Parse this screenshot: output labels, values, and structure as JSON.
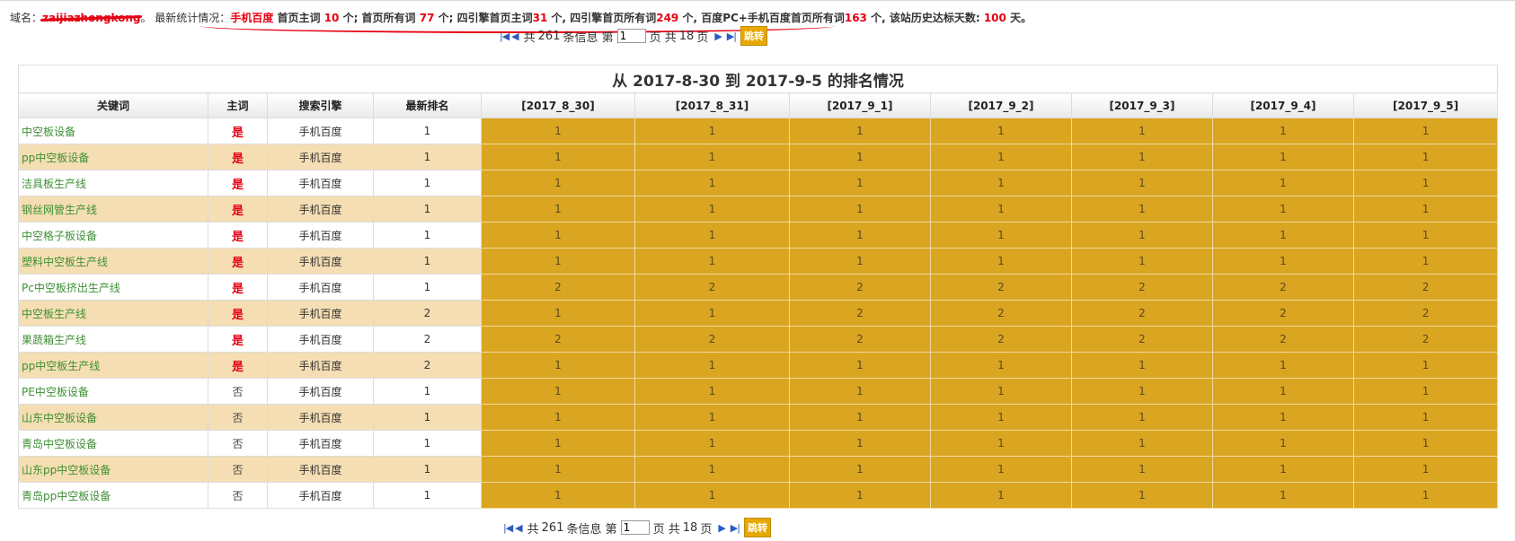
{
  "stats": {
    "domain_label": "域名：",
    "domain_value": "zaijiazhongkong",
    "intro": "。 最新统计情况：",
    "engine": "手机百度",
    "p1": " 首页主词 ",
    "home_main": "10",
    "p2": " 个; 首页所有词 ",
    "home_all": "77",
    "p3": " 个; 四引擎首页主词",
    "four_main": "31",
    "p4": " 个, 四引擎首页所有词",
    "four_all": "249",
    "p5": " 个, 百度PC+手机百度首页所有词",
    "pc_mobile_all": "163",
    "p6": " 个, 该站历史达标天数: ",
    "days": "100",
    "p7": " 天。"
  },
  "pager": {
    "total_prefix": "共",
    "total": "261",
    "total_suffix": "条信息 第",
    "page_value": "1",
    "pages_prefix": "页 共",
    "pages": "18",
    "pages_suffix": "页",
    "jump_label": "跳转"
  },
  "table": {
    "title": "从 2017-8-30 到 2017-9-5 的排名情况",
    "headers": [
      "关键词",
      "主词",
      "搜索引擎",
      "最新排名",
      "[2017_8_30]",
      "[2017_8_31]",
      "[2017_9_1]",
      "[2017_9_2]",
      "[2017_9_3]",
      "[2017_9_4]",
      "[2017_9_5]"
    ],
    "rows": [
      {
        "keyword": "中空板设备",
        "main": "是",
        "engine": "手机百度",
        "rank": "1",
        "days": [
          "1",
          "1",
          "1",
          "1",
          "1",
          "1",
          "1"
        ]
      },
      {
        "keyword": "pp中空板设备",
        "main": "是",
        "engine": "手机百度",
        "rank": "1",
        "days": [
          "1",
          "1",
          "1",
          "1",
          "1",
          "1",
          "1"
        ]
      },
      {
        "keyword": "洁具板生产线",
        "main": "是",
        "engine": "手机百度",
        "rank": "1",
        "days": [
          "1",
          "1",
          "1",
          "1",
          "1",
          "1",
          "1"
        ]
      },
      {
        "keyword": "钢丝网管生产线",
        "main": "是",
        "engine": "手机百度",
        "rank": "1",
        "days": [
          "1",
          "1",
          "1",
          "1",
          "1",
          "1",
          "1"
        ]
      },
      {
        "keyword": "中空格子板设备",
        "main": "是",
        "engine": "手机百度",
        "rank": "1",
        "days": [
          "1",
          "1",
          "1",
          "1",
          "1",
          "1",
          "1"
        ]
      },
      {
        "keyword": "塑料中空板生产线",
        "main": "是",
        "engine": "手机百度",
        "rank": "1",
        "days": [
          "1",
          "1",
          "1",
          "1",
          "1",
          "1",
          "1"
        ]
      },
      {
        "keyword": "Pc中空板挤出生产线",
        "main": "是",
        "engine": "手机百度",
        "rank": "1",
        "days": [
          "2",
          "2",
          "2",
          "2",
          "2",
          "2",
          "2"
        ]
      },
      {
        "keyword": "中空板生产线",
        "main": "是",
        "engine": "手机百度",
        "rank": "2",
        "days": [
          "1",
          "1",
          "2",
          "2",
          "2",
          "2",
          "2"
        ]
      },
      {
        "keyword": "果蔬箱生产线",
        "main": "是",
        "engine": "手机百度",
        "rank": "2",
        "days": [
          "2",
          "2",
          "2",
          "2",
          "2",
          "2",
          "2"
        ]
      },
      {
        "keyword": "pp中空板生产线",
        "main": "是",
        "engine": "手机百度",
        "rank": "2",
        "days": [
          "1",
          "1",
          "1",
          "1",
          "1",
          "1",
          "1"
        ]
      },
      {
        "keyword": "PE中空板设备",
        "main": "否",
        "engine": "手机百度",
        "rank": "1",
        "days": [
          "1",
          "1",
          "1",
          "1",
          "1",
          "1",
          "1"
        ]
      },
      {
        "keyword": "山东中空板设备",
        "main": "否",
        "engine": "手机百度",
        "rank": "1",
        "days": [
          "1",
          "1",
          "1",
          "1",
          "1",
          "1",
          "1"
        ]
      },
      {
        "keyword": "青岛中空板设备",
        "main": "否",
        "engine": "手机百度",
        "rank": "1",
        "days": [
          "1",
          "1",
          "1",
          "1",
          "1",
          "1",
          "1"
        ]
      },
      {
        "keyword": "山东pp中空板设备",
        "main": "否",
        "engine": "手机百度",
        "rank": "1",
        "days": [
          "1",
          "1",
          "1",
          "1",
          "1",
          "1",
          "1"
        ]
      },
      {
        "keyword": "青岛pp中空板设备",
        "main": "否",
        "engine": "手机百度",
        "rank": "1",
        "days": [
          "1",
          "1",
          "1",
          "1",
          "1",
          "1",
          "1"
        ]
      }
    ]
  },
  "icons": {
    "first": "first-page-icon",
    "prev": "prev-page-icon",
    "next": "next-page-icon",
    "last": "last-page-icon"
  },
  "colors": {
    "accent_red": "#e60012",
    "keyword_green": "#3e9034",
    "day_cell": "#daa520",
    "stripe": "#f5deb3",
    "jump_button": "#e7a800"
  }
}
